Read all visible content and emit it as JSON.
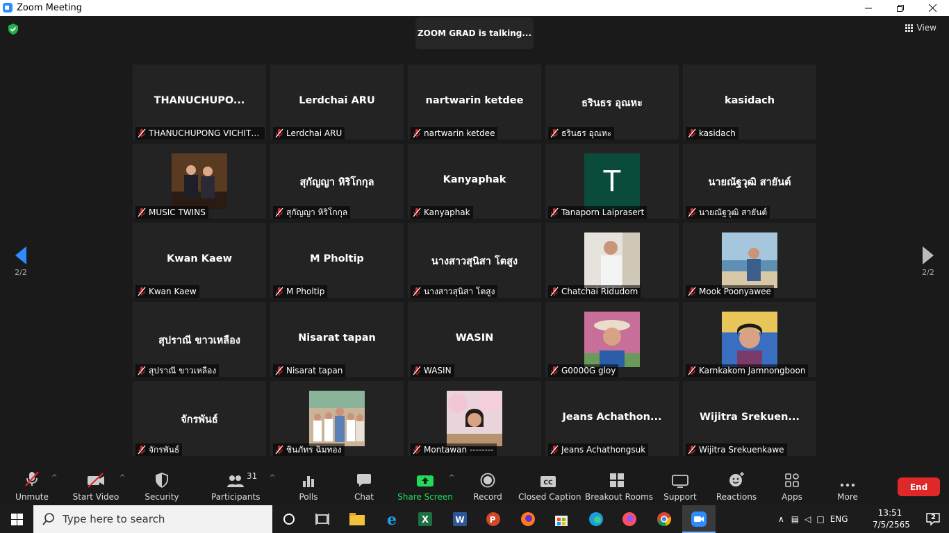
{
  "window": {
    "title": "Zoom Meeting"
  },
  "header": {
    "talking": "ZOOM GRAD is talking...",
    "view_label": "View"
  },
  "pagination": {
    "left": "2/2",
    "right": "2/2"
  },
  "tiles": [
    {
      "big": "THANUCHUPO...",
      "name": "THANUCHUPONG VICHITP..."
    },
    {
      "big": "Lerdchai ARU",
      "name": "Lerdchai ARU"
    },
    {
      "big": "nartwarin ketdee",
      "name": "nartwarin ketdee"
    },
    {
      "big": "ธรินธร อุณหะ",
      "name": "ธรินธร อุณหะ"
    },
    {
      "big": "kasidach",
      "name": "kasidach"
    },
    {
      "big": "",
      "name": "MUSIC TWINS",
      "photo": "duo"
    },
    {
      "big": "สุกัญญา หิริโกกุล",
      "name": "สุกัญญา หิริโกกุล"
    },
    {
      "big": "Kanyaphak",
      "name": "Kanyaphak"
    },
    {
      "big": "",
      "name": "Tanaporn Laiprasert",
      "avatar": "T"
    },
    {
      "big": "นายณัฐวุฒิ สายันต์",
      "name": "นายณัฐวุฒิ สายันต์"
    },
    {
      "big": "Kwan Kaew",
      "name": "Kwan Kaew"
    },
    {
      "big": "M Pholtip",
      "name": "M Pholtip"
    },
    {
      "big": "นางสาวสุนิสา โตสูง",
      "name": "นางสาวสุนิสา โตสูง"
    },
    {
      "big": "",
      "name": "Chatchai Ridudom",
      "photo": "man"
    },
    {
      "big": "",
      "name": "Mook Poonyawee",
      "photo": "beach"
    },
    {
      "big": "สุปราณี ขาวเหลือง",
      "name": "สุปราณี ขาวเหลือง"
    },
    {
      "big": "Nisarat tapan",
      "name": "Nisarat tapan"
    },
    {
      "big": "WASIN",
      "name": "WASIN"
    },
    {
      "big": "",
      "name": "G0000G gloy",
      "photo": "hat"
    },
    {
      "big": "",
      "name": "Karnkakom Jamnongboon",
      "photo": "selfie"
    },
    {
      "big": "จักรพันธ์",
      "name": "จักรพันธ์"
    },
    {
      "big": "",
      "name": "ชินภัทร ฉิมทอง",
      "photo": "kids"
    },
    {
      "big": "",
      "name": "Montawan --------",
      "photo": "blossom"
    },
    {
      "big": "Jeans  Achathon...",
      "name": "Jeans Achathongsuk"
    },
    {
      "big": "Wijitra  Srekuen...",
      "name": "Wijitra Srekuenkawe"
    }
  ],
  "toolbar": {
    "unmute": "Unmute",
    "start_video": "Start Video",
    "security": "Security",
    "participants": "Participants",
    "participants_count": "31",
    "polls": "Polls",
    "chat": "Chat",
    "share_screen": "Share Screen",
    "record": "Record",
    "closed_caption": "Closed Caption",
    "breakout_rooms": "Breakout Rooms",
    "support": "Support",
    "reactions": "Reactions",
    "apps": "Apps",
    "more": "More",
    "end": "End"
  },
  "taskbar": {
    "search_placeholder": "Type here to search",
    "language": "ENG",
    "time": "13:51",
    "date": "7/5/2565",
    "notification_count": "2"
  },
  "colors": {
    "share_green": "#23d959",
    "end_red": "#e02828",
    "zoom_blue": "#2d8cff"
  }
}
